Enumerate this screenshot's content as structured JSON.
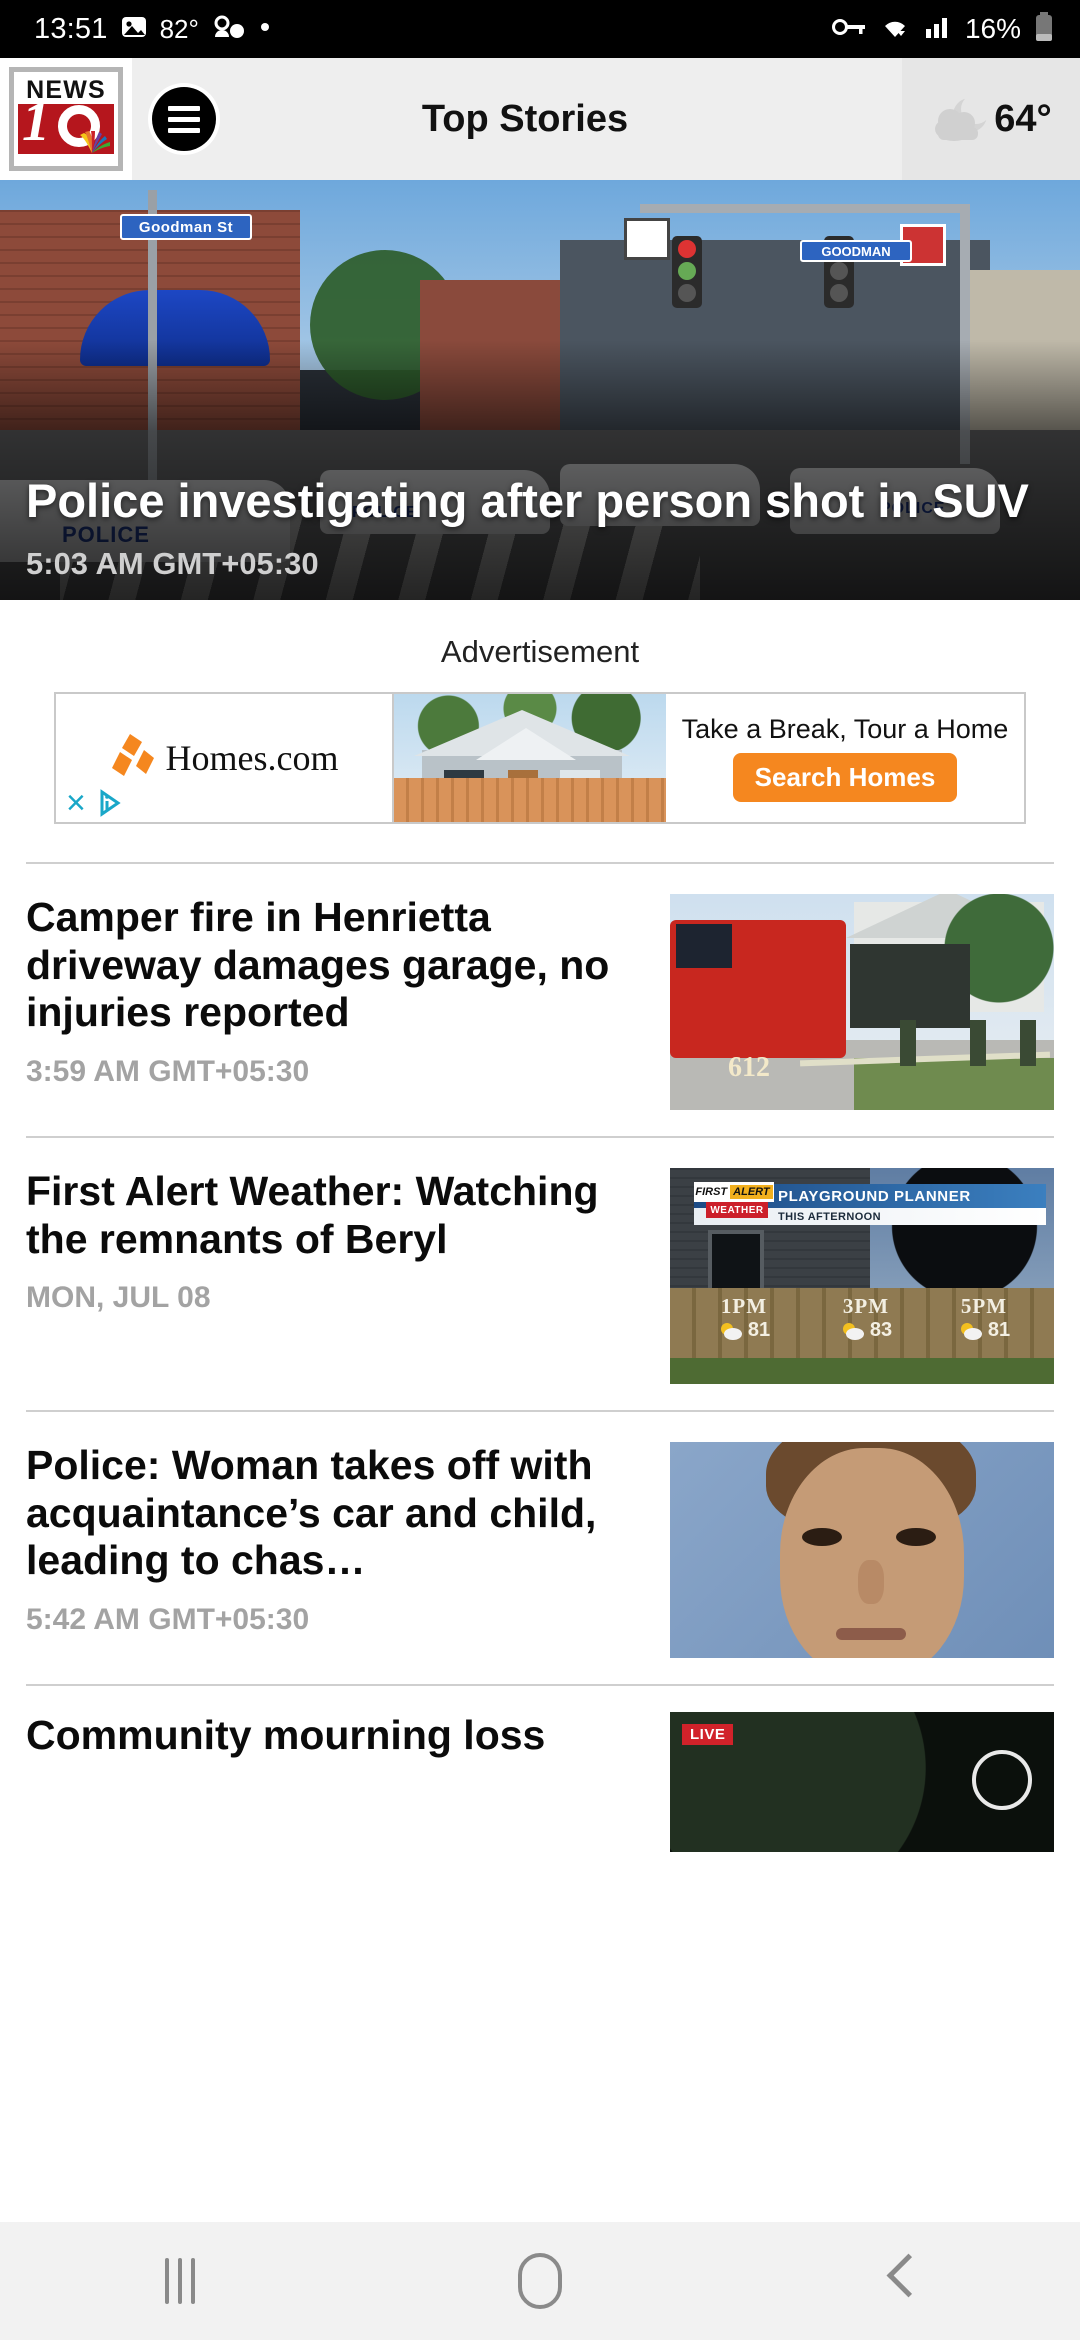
{
  "statusbar": {
    "time": "13:51",
    "temperature": "82°",
    "battery_percent": "16%",
    "icons": [
      "photo-icon",
      "contacts-icon",
      "dot-icon",
      "key-icon",
      "wifi-icon",
      "signal-icon",
      "battery-icon"
    ]
  },
  "header": {
    "logo": {
      "news_text": "NEWS",
      "channel_number": "10",
      "network": "nbc-peacock"
    },
    "menu_label": "hamburger-menu",
    "title": "Top Stories",
    "weather": {
      "temp": "64°",
      "icon": "partly-cloudy-night-icon"
    }
  },
  "hero": {
    "headline": "Police investigating after person shot in SUV",
    "time": "5:03 AM GMT+05:30",
    "image_alt": "police-scene-street",
    "street_sign_1": "Goodman St",
    "street_sign_2": "GOODMAN",
    "car_label": "POLICE"
  },
  "ad": {
    "label": "Advertisement",
    "brand": "Homes.com",
    "headline": "Take a Break, Tour a Home",
    "cta": "Search Homes",
    "close_label": "×",
    "info_label": "ad-choices"
  },
  "articles": [
    {
      "title": "Camper fire in Henrietta driveway damages garage, no injuries reported",
      "time": "3:59 AM GMT+05:30",
      "thumb": "fire-truck-scene",
      "truck_number": "612"
    },
    {
      "title": "First Alert Weather: Watching the remnants of Beryl",
      "time": "MON, JUL 08",
      "thumb": "playground-planner-graphic",
      "graphic": {
        "brand_first": "FIRST",
        "brand_alert": "ALERT",
        "brand_weather": "WEATHER",
        "title": "PLAYGROUND PLANNER",
        "subtitle": "THIS AFTERNOON",
        "forecast": [
          {
            "hour": "1PM",
            "temp": "81"
          },
          {
            "hour": "3PM",
            "temp": "83"
          },
          {
            "hour": "5PM",
            "temp": "81"
          }
        ]
      }
    },
    {
      "title": "Police: Woman takes off with acquaintance’s car and child, leading to chas…",
      "time": "5:42 AM GMT+05:30",
      "thumb": "mugshot-photo"
    }
  ],
  "partial_article": {
    "title": "Community mourning loss",
    "thumb": "live-video-thumbnail",
    "badge": "LIVE"
  },
  "navbar": {
    "recent_label": "recent-apps",
    "home_label": "home",
    "back_label": "back"
  },
  "colors": {
    "accent_red": "#b5161d",
    "ad_orange": "#f5871f",
    "header_bg": "#eeeeee",
    "live_red": "#d1222a"
  }
}
